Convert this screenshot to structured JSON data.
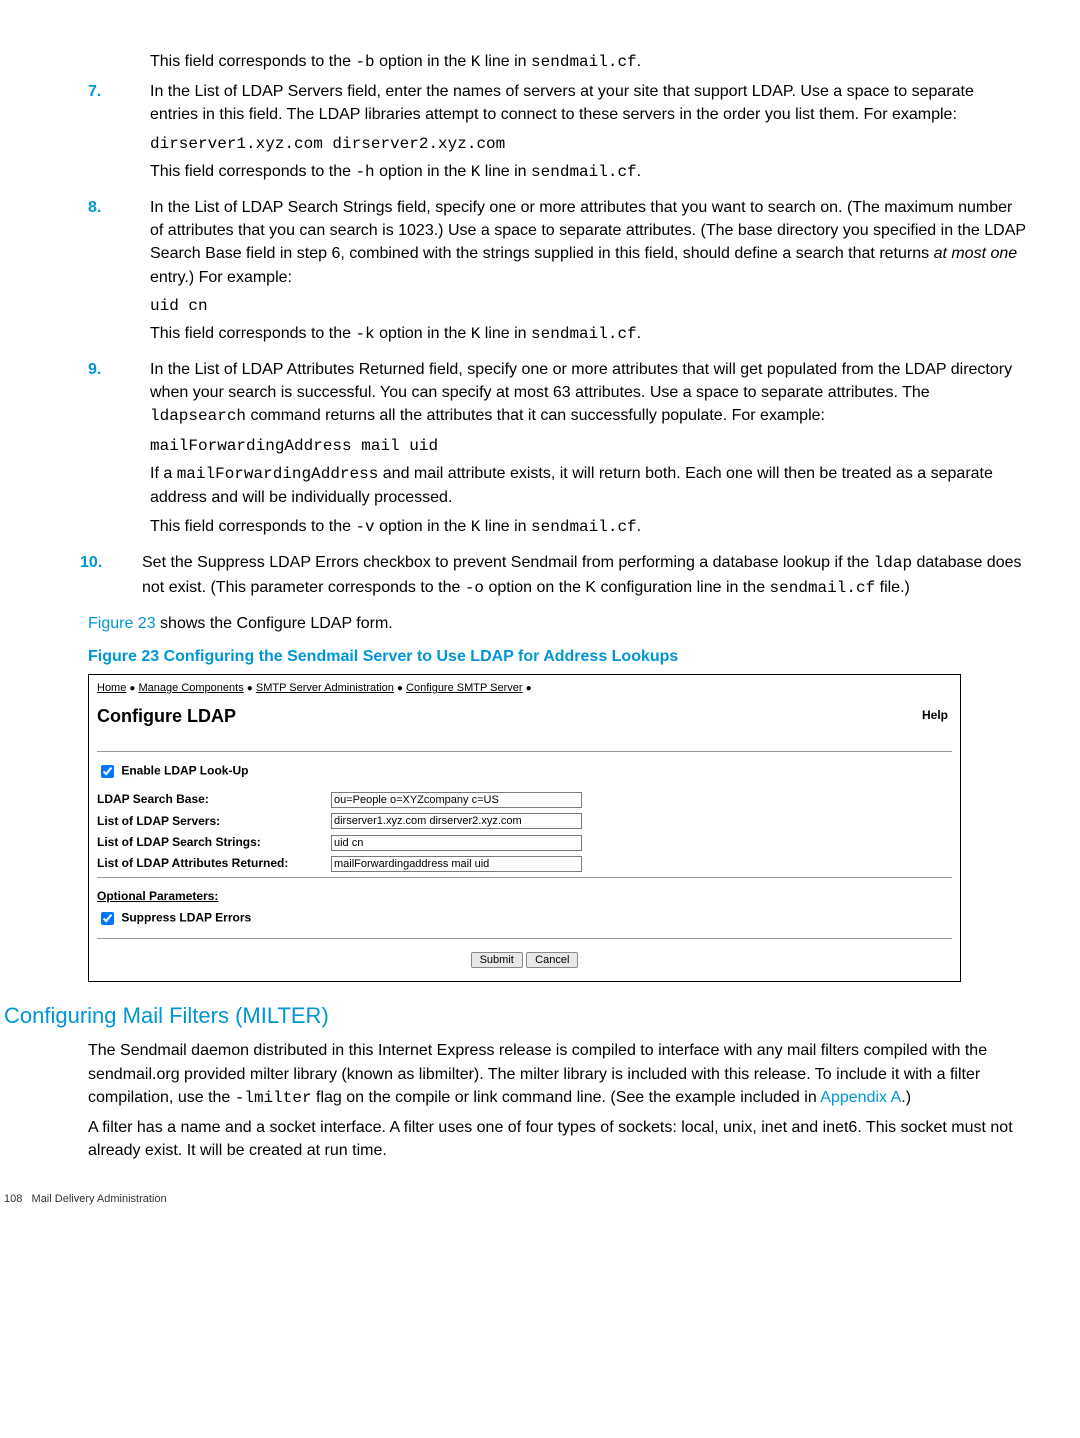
{
  "pre_item": "This field corresponds to the -b option in the K line in sendmail.cf.",
  "items": {
    "7": {
      "num": "7.",
      "p1": "In the List of LDAP Servers field, enter the names of servers at your site that support LDAP. Use a space to separate entries in this field. The LDAP libraries attempt to connect to these servers in the order you list them. For example:",
      "code": "dirserver1.xyz.com dirserver2.xyz.com",
      "p2": "This field corresponds to the -h option in the K line in sendmail.cf."
    },
    "8": {
      "num": "8.",
      "p1_a": "In the List of LDAP Search Strings field, specify one or more attributes that you want to search on. (The maximum number of attributes that you can search is 1023.) Use a space to separate attributes. (The base directory you specified in the LDAP Search Base field in step 6, combined with the strings supplied in this field, should define a search that returns ",
      "p1_em": "at most one",
      "p1_b": " entry.) For example:",
      "code": "uid cn",
      "p2": "This field corresponds to the -k option in the K line in sendmail.cf."
    },
    "9": {
      "num": "9.",
      "p1": "In the List of LDAP Attributes Returned field, specify one or more attributes that will get populated from the LDAP directory when your search is successful. You can specify at most 63 attributes. Use a space to separate attributes. The ldapsearch command returns all the attributes that it can successfully populate. For example:",
      "code": "mailForwardingAddress mail uid",
      "p2": "If a mailForwardingAddress and mail attribute exists, it will return both. Each one will then be treated as a separate address and will be individually processed.",
      "p3": "This field corresponds to the -v option in the K line in sendmail.cf."
    },
    "10": {
      "num": "10.",
      "p1": "Set the Suppress LDAP Errors checkbox to prevent Sendmail from performing a database lookup if the ldap database does not exist. (This parameter corresponds to the -o option on the K configuration line in the sendmail.cf file.)"
    }
  },
  "fig_intro_a": "Figure 23",
  "fig_intro_b": " shows the Configure LDAP form.",
  "fig_caption": "Figure 23 Configuring the Sendmail Server to Use LDAP for Address Lookups",
  "shot": {
    "bc": {
      "home": "Home",
      "mc": "Manage Components",
      "smtp": "SMTP Server Administration",
      "cfg": "Configure SMTP Server",
      "sep": "●"
    },
    "title": "Configure LDAP",
    "help": "Help",
    "enable_label": "Enable LDAP Look-Up",
    "rows": {
      "base": {
        "label": "LDAP Search Base:",
        "value": "ou=People o=XYZcompany c=US"
      },
      "servers": {
        "label": "List of LDAP Servers:",
        "value": "dirserver1.xyz.com dirserver2.xyz.com"
      },
      "strings": {
        "label": "List of LDAP Search Strings:",
        "value": "uid cn"
      },
      "attrs": {
        "label": "List of LDAP Attributes Returned:",
        "value": "mailForwardingaddress mail uid"
      }
    },
    "opt_head": "Optional Parameters:",
    "suppress_label": "Suppress LDAP Errors",
    "submit": "Submit",
    "cancel": "Cancel"
  },
  "section_heading": "Configuring Mail Filters (MILTER)",
  "sec_p1_a": "The Sendmail daemon distributed in this Internet Express release is compiled to interface with any mail filters compiled with the sendmail.org provided milter library (known as libmilter). The milter library is included with this release. To include it with a filter compilation, use the ",
  "sec_p1_mono": "-lmilter",
  "sec_p1_b": " flag on the compile or link command line. (See the example included in ",
  "sec_p1_link": "Appendix A",
  "sec_p1_c": ".)",
  "sec_p2": "A filter has a name and a socket interface. A filter uses one of four types of sockets: local, unix, inet and inet6. This socket must not already exist. It will be created at run time.",
  "footer_num": "108",
  "footer_text": "Mail Delivery Administration"
}
